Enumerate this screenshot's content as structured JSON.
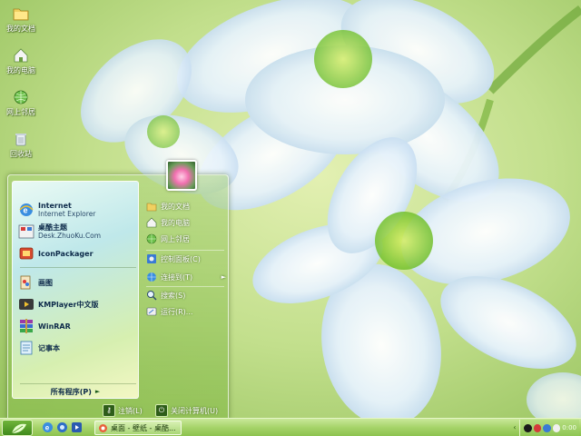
{
  "desktop": {
    "icons": [
      {
        "label": "我的文档",
        "icon": "folder-icon"
      },
      {
        "label": "我的电脑",
        "icon": "computer-icon"
      },
      {
        "label": "网上邻居",
        "icon": "network-icon"
      },
      {
        "label": "回收站",
        "icon": "recycle-bin-icon"
      }
    ]
  },
  "start_menu": {
    "programs": [
      {
        "name": "Internet",
        "sub": "Internet Explorer",
        "icon": "ie-icon"
      },
      {
        "name": "桌酷主题",
        "sub": "Desk.ZhuoKu.Com",
        "icon": "zhuoku-icon"
      },
      {
        "name": "IconPackager",
        "sub": "",
        "icon": "iconpackager-icon"
      },
      {
        "name": "画图",
        "sub": "",
        "icon": "paint-icon"
      },
      {
        "name": "KMPlayer中文版",
        "sub": "",
        "icon": "kmplayer-icon"
      },
      {
        "name": "WinRAR",
        "sub": "",
        "icon": "winrar-icon"
      },
      {
        "name": "记事本",
        "sub": "",
        "icon": "notepad-icon"
      }
    ],
    "all_programs": "所有程序(P)",
    "places": [
      {
        "label": "我的文档",
        "icon": "folder-icon",
        "submenu": false
      },
      {
        "label": "我的电脑",
        "icon": "computer-icon",
        "submenu": false
      },
      {
        "label": "网上邻居",
        "icon": "network-icon",
        "submenu": false
      },
      {
        "label": "控制面板(C)",
        "icon": "control-panel-icon",
        "submenu": false
      },
      {
        "label": "连接到(T)",
        "icon": "connect-icon",
        "submenu": true
      },
      {
        "label": "搜索(S)",
        "icon": "search-icon",
        "submenu": false
      },
      {
        "label": "运行(R)...",
        "icon": "run-icon",
        "submenu": false
      }
    ],
    "logoff": "注销(L)",
    "shutdown": "关闭计算机(U)"
  },
  "taskbar": {
    "task_label": "桌面 - 壁纸 - 桌酷...",
    "clock": "0:00"
  },
  "colors": {
    "accent": "#8cc24e",
    "start_button": "#3f8a1c"
  }
}
